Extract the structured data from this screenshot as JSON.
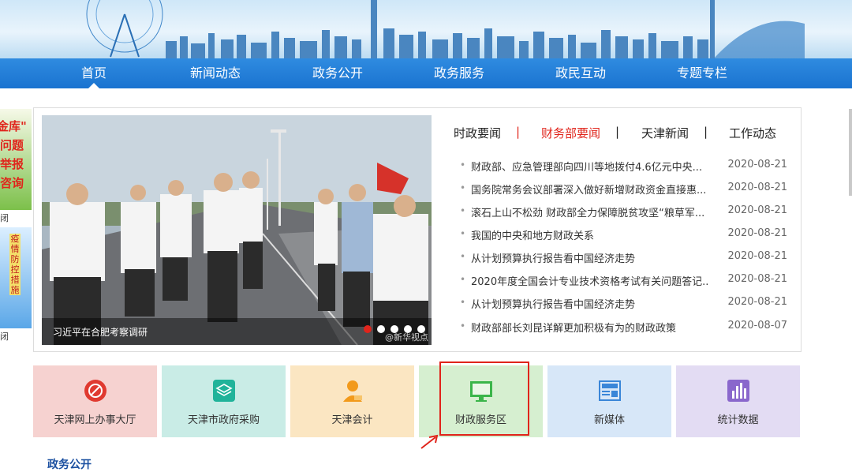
{
  "nav": {
    "items": [
      {
        "label": "首页",
        "active": true
      },
      {
        "label": "新闻动态"
      },
      {
        "label": "政务公开"
      },
      {
        "label": "政务服务"
      },
      {
        "label": "政民互动"
      },
      {
        "label": "专题专栏"
      }
    ]
  },
  "side_ads": {
    "ad1_lines": [
      "金库\"",
      "问题",
      "举报",
      "咨询"
    ],
    "ad1_close": "闭",
    "ad2_text": "疫情防控措施",
    "ad2_close": "闭"
  },
  "slider": {
    "caption": "习近平在合肥考察调研",
    "watermark": "@新华视点",
    "dots": 5,
    "active_dot": 0
  },
  "tabs": {
    "items": [
      {
        "label": "时政要闻"
      },
      {
        "label": "财务部要闻",
        "active": true
      },
      {
        "label": "天津新闻"
      },
      {
        "label": "工作动态"
      }
    ],
    "separator": "|"
  },
  "news": [
    {
      "title": "财政部、应急管理部向四川等地拨付4.6亿元中央...",
      "date": "2020-08-21"
    },
    {
      "title": "国务院常务会议部署深入做好新增财政资金直接惠...",
      "date": "2020-08-21"
    },
    {
      "title": "滚石上山不松劲 财政部全力保障脱贫攻坚“粮草军...",
      "date": "2020-08-21"
    },
    {
      "title": "我国的中央和地方财政关系",
      "date": "2020-08-21"
    },
    {
      "title": "从计划预算执行报告看中国经济走势",
      "date": "2020-08-21"
    },
    {
      "title": "2020年度全国会计专业技术资格考试有关问题答记...",
      "date": "2020-08-21"
    },
    {
      "title": "从计划预算执行报告看中国经济走势",
      "date": "2020-08-21"
    },
    {
      "title": "财政部部长刘昆详解更加积极有为的财政政策",
      "date": "2020-08-07"
    }
  ],
  "tiles": [
    {
      "label": "天津网上办事大厅",
      "icon": "globe-icon",
      "bg": "#f6d2d0",
      "color": "#e03a30"
    },
    {
      "label": "天津市政府采购",
      "icon": "layers-icon",
      "bg": "#c9ece6",
      "color": "#20b39a"
    },
    {
      "label": "天津会计",
      "icon": "person-icon",
      "bg": "#fbe6c2",
      "color": "#f29a1b"
    },
    {
      "label": "财政服务区",
      "icon": "monitor-icon",
      "bg": "#d6efd0",
      "color": "#3bb54a"
    },
    {
      "label": "新媒体",
      "icon": "news-icon",
      "bg": "#d7e7f8",
      "color": "#3a86d8"
    },
    {
      "label": "统计数据",
      "icon": "bar-chart-icon",
      "bg": "#e3dcf3",
      "color": "#8a67cc"
    }
  ],
  "bottom_title": "政务公开"
}
